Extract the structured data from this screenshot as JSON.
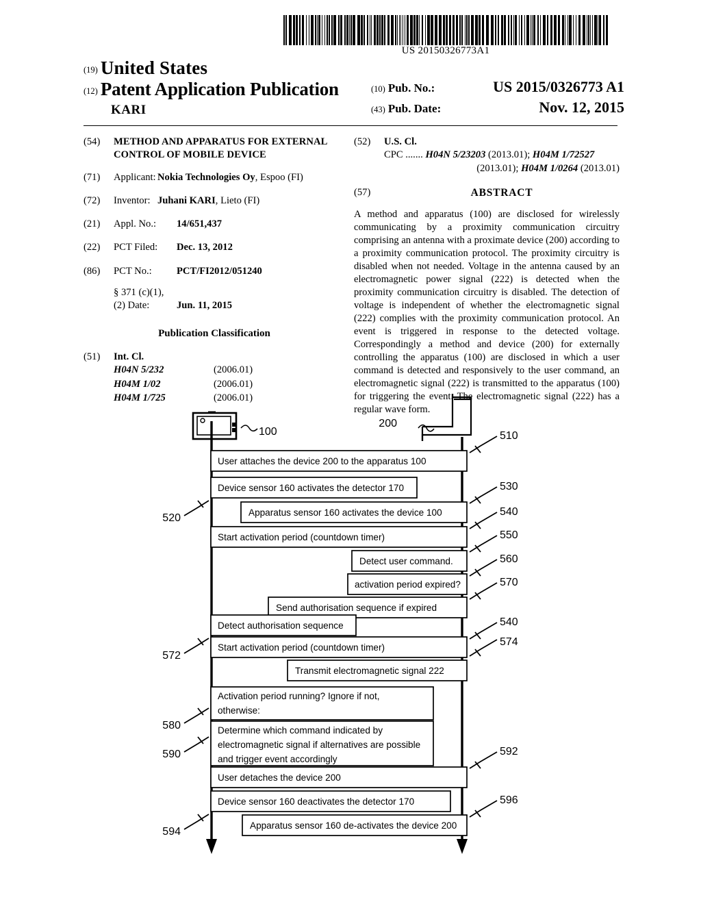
{
  "barcode": {
    "number": "US 20150326773A1",
    "icon": "barcode-icon"
  },
  "header": {
    "code19": "(19)",
    "country": "United States",
    "code12": "(12)",
    "doc_type": "Patent Application Publication",
    "inventor_surname": "KARI",
    "pubno_code": "(10)",
    "pubno_label": "Pub. No.:",
    "pubno_value": "US 2015/0326773 A1",
    "pubdate_code": "(43)",
    "pubdate_label": "Pub. Date:",
    "pubdate_value": "Nov. 12, 2015"
  },
  "left_column": {
    "title_code": "(54)",
    "title_line1": "METHOD AND APPARATUS FOR EXTERNAL",
    "title_line2": "CONTROL OF MOBILE DEVICE",
    "applicant_code": "(71)",
    "applicant_label": "Applicant:",
    "applicant_name": "Nokia Technologies Oy",
    "applicant_rest": ", Espoo (FI)",
    "inventor_code": "(72)",
    "inventor_label": "Inventor:",
    "inventor_name": "Juhani KARI",
    "inventor_rest": ", Lieto (FI)",
    "applno_code": "(21)",
    "applno_label": "Appl. No.:",
    "applno_value": "14/651,437",
    "pctfiled_code": "(22)",
    "pctfiled_label": "PCT Filed:",
    "pctfiled_value": "Dec. 13, 2012",
    "pctno_code": "(86)",
    "pctno_label": "PCT No.:",
    "pctno_value": "PCT/FI2012/051240",
    "s371_line1": "§ 371 (c)(1),",
    "s371_label": "(2) Date:",
    "s371_value": "Jun. 11, 2015",
    "pub_classification": "Publication Classification",
    "intcl_code": "(51)",
    "intcl_label": "Int. Cl.",
    "intcl_rows": [
      {
        "code": "H04N 5/232",
        "year": "(2006.01)"
      },
      {
        "code": "H04M 1/02",
        "year": "(2006.01)"
      },
      {
        "code": "H04M 1/725",
        "year": "(2006.01)"
      }
    ]
  },
  "right_column": {
    "uscl_code": "(52)",
    "uscl_label": "U.S. Cl.",
    "cpc_prefix": "CPC  .......",
    "cpc_1": "H04N 5/23203",
    "cpc_1_year": " (2013.01); ",
    "cpc_2": "H04M 1/72527",
    "cpc_2_year": "(2013.01); ",
    "cpc_3": "H04M 1/0264",
    "cpc_3_year": " (2013.01)",
    "abstract_code": "(57)",
    "abstract_heading": "ABSTRACT",
    "abstract_text": "A method and apparatus (100) are disclosed for wirelessly communicating by a proximity communication circuitry comprising an antenna with a proximate device (200) according to a proximity communication protocol. The proximity circuitry is disabled when not needed. Voltage in the antenna caused by an electromagnetic power signal (222) is detected when the proximity communication circuitry is disabled. The detection of voltage is independent of whether the electromagnetic signal (222) complies with the proximity communication protocol. An event is triggered in response to the detected voltage. Correspondingly a method and device (200) for externally controlling the apparatus (100) are disclosed in which a user command is detected and responsively to the user command, an electromagnetic signal (222) is transmitted to the apparatus (100) for triggering the event. The electromagnetic signal (222) has a regular wave form."
  },
  "figure": {
    "device_label_100": "100",
    "device_label_200": "200",
    "steps": [
      {
        "ref": "510",
        "text": "User attaches the device 200 to the apparatus 100"
      },
      {
        "ref": "520",
        "text": "Device sensor 160 activates the detector 170"
      },
      {
        "ref": "530",
        "text": "Apparatus sensor 160 activates the device 100"
      },
      {
        "ref": "540",
        "text": "Start activation period (countdown timer)"
      },
      {
        "ref": "550",
        "text": "Detect user command."
      },
      {
        "ref": "560",
        "text": "activation period expired?"
      },
      {
        "ref": "570",
        "text": "Send authorisation sequence  if expired"
      },
      {
        "ref": "572",
        "text": "Detect authorisation sequence"
      },
      {
        "ref": "540b",
        "text": "Start activation period (countdown timer)"
      },
      {
        "ref": "574",
        "text": "Transmit electromagnetic signal 222"
      },
      {
        "ref": "580",
        "text": "Activation period running? Ignore if not, otherwise:"
      },
      {
        "ref": "590",
        "text": "Determine which command indicated by electromagnetic signal if alternatives are possible and trigger event accordingly"
      },
      {
        "ref": "592",
        "text": "User detaches the device 200"
      },
      {
        "ref": "594",
        "text": "Device sensor 160 deactivates the detector 170"
      },
      {
        "ref": "596",
        "text": "Apparatus sensor 160 de-activates the device 200"
      }
    ],
    "box_580_line1": "Activation period running? Ignore if not,",
    "box_580_line2": "otherwise:",
    "box_590_line1": "Determine which command indicated by",
    "box_590_line2": "electromagnetic signal if alternatives are possible",
    "box_590_line3": "and trigger event accordingly",
    "refs": {
      "r510": "510",
      "r520": "520",
      "r530": "530",
      "r540": "540",
      "r550": "550",
      "r560": "560",
      "r570": "570",
      "r572": "572",
      "r540b": "540",
      "r574": "574",
      "r580": "580",
      "r590": "590",
      "r592": "592",
      "r594": "594",
      "r596": "596"
    }
  }
}
